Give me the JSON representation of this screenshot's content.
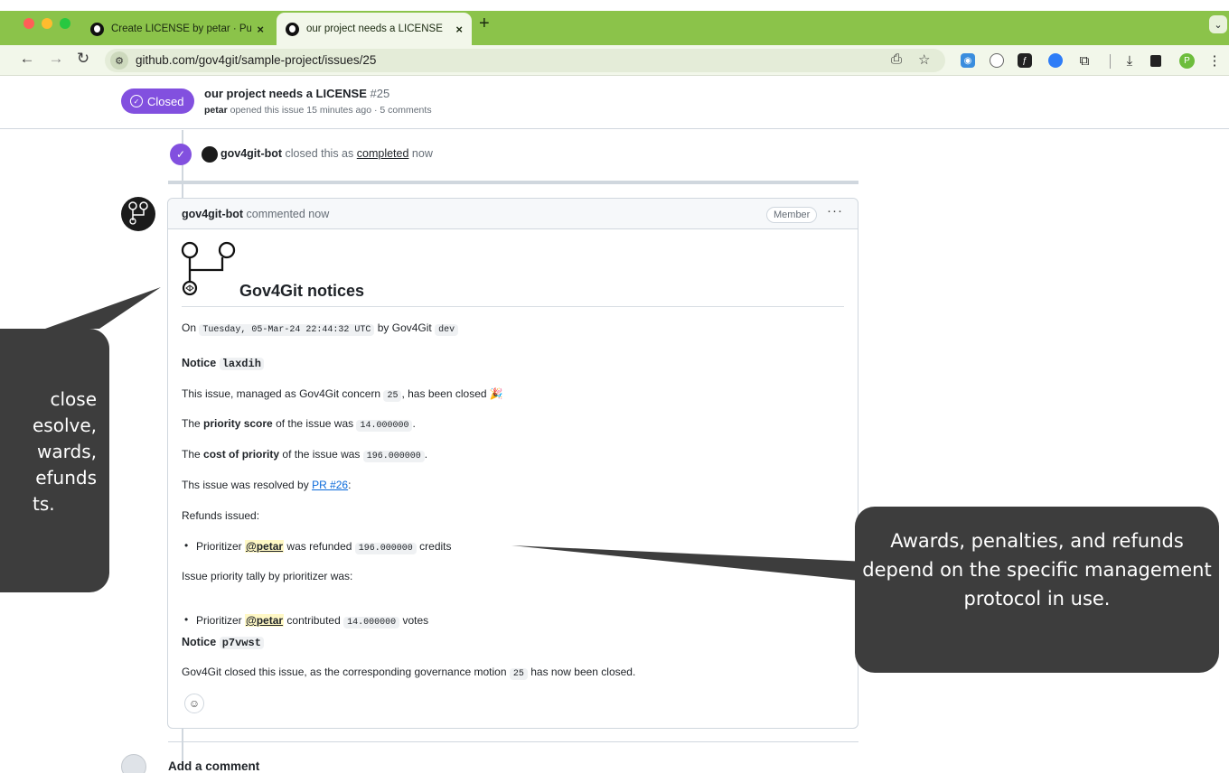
{
  "browser": {
    "tabs": [
      {
        "title": "Create LICENSE by petar · Pu",
        "active": false
      },
      {
        "title": "our project needs a LICENSE",
        "active": true
      }
    ],
    "url": "github.com/gov4git/sample-project/issues/25",
    "profile_initial": "P"
  },
  "issue": {
    "state": "Closed",
    "title": "our project needs a LICENSE",
    "number": "#25",
    "author": "petar",
    "meta": "opened this issue 15 minutes ago · 5 comments"
  },
  "event": {
    "actor": "gov4git-bot",
    "pre": "closed this as",
    "link": "completed",
    "post": "now"
  },
  "comment": {
    "author": "gov4git-bot",
    "action": "commented now",
    "role": "Member",
    "heading": "Gov4Git notices",
    "on_prefix": "On",
    "date_code": "Tuesday, 05-Mar-24 22:44:32 UTC",
    "by_text": "by Gov4Git",
    "dev_code": "dev",
    "notice1_label": "Notice",
    "notice1_id": "laxdih",
    "managed_pre": "This issue, managed as Gov4Git concern",
    "concern_id": "25",
    "managed_post": ", has been closed 🎉",
    "priority_pre": "The",
    "priority_bold": "priority score",
    "priority_mid": "of the issue was",
    "priority_value": "14.000000",
    "cost_pre": "The",
    "cost_bold": "cost of priority",
    "cost_mid": "of the issue was",
    "cost_value": "196.000000",
    "resolved_pre": "Ths issue was resolved by",
    "resolved_link": "PR #26",
    "refunds_label": "Refunds issued:",
    "refund_pre": "Prioritizer",
    "refund_user": "@petar",
    "refund_mid": "was refunded",
    "refund_value": "196.000000",
    "refund_post": "credits",
    "tally_label": "Issue priority tally by prioritizer was:",
    "tally_pre": "Prioritizer",
    "tally_user": "@petar",
    "tally_mid": "contributed",
    "tally_value": "14.000000",
    "tally_post": "votes",
    "notice2_label": "Notice",
    "notice2_id": "p7vwst",
    "closed_pre": "Gov4Git closed this issue, as the corresponding governance motion",
    "motion_id": "25",
    "closed_post": "has now been closed."
  },
  "add_comment": "Add a comment",
  "callouts": {
    "left_lines": [
      "close",
      "esolve,",
      "wards,",
      "efunds",
      "ts."
    ],
    "right_text": "Awards, penalties, and refunds depend on the specific management protocol in use."
  },
  "colors": {
    "closed_purple": "#8250df",
    "chrome_green": "#8bc34a",
    "callout_bg": "#3d3d3d",
    "link_blue": "#0969da"
  }
}
